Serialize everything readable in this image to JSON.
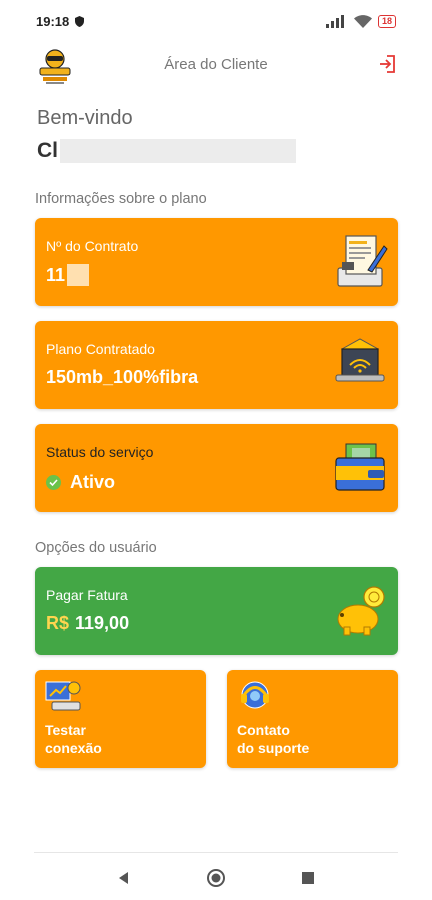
{
  "status_bar": {
    "time": "19:18",
    "battery": "18"
  },
  "header": {
    "title": "Área do Cliente"
  },
  "welcome": "Bem-vindo",
  "client_name": "Cl",
  "plan_section": {
    "title": "Informações sobre o plano",
    "contract": {
      "label": "Nº do Contrato",
      "value": "11"
    },
    "plan": {
      "label": "Plano Contratado",
      "value": "150mb_100%fibra"
    },
    "service_status": {
      "label": "Status do serviço",
      "value": "Ativo"
    }
  },
  "user_section": {
    "title": "Opções do usuário",
    "pay_invoice": {
      "label": "Pagar Fatura",
      "currency": "R$",
      "amount": "119,00"
    },
    "test_connection": {
      "label_line1": "Testar",
      "label_line2": "conexão"
    },
    "support_contact": {
      "label_line1": "Contato",
      "label_line2": "do suporte"
    }
  },
  "colors": {
    "orange": "#ff9800",
    "green": "#43a745",
    "active_dot": "#6cc24a"
  }
}
